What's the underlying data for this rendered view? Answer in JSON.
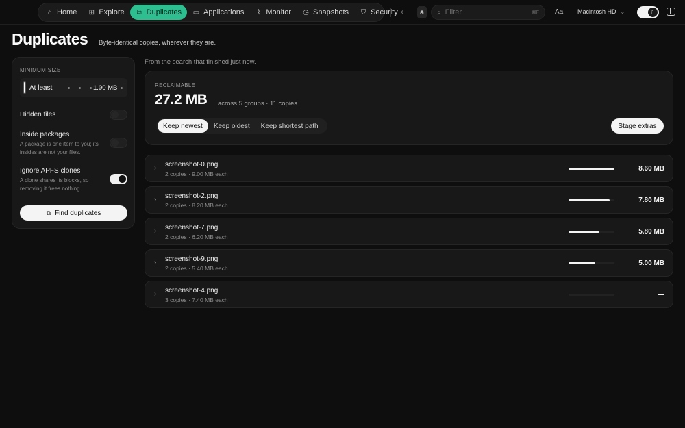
{
  "nav": {
    "items": [
      {
        "label": "Home",
        "icon": "home-icon",
        "glyph": "⌂",
        "active": false
      },
      {
        "label": "Explore",
        "icon": "grid-icon",
        "glyph": "⊞",
        "active": false
      },
      {
        "label": "Duplicates",
        "icon": "copy-icon",
        "glyph": "⧉",
        "active": true
      },
      {
        "label": "Applications",
        "icon": "monitor-icon",
        "glyph": "▭",
        "active": false
      },
      {
        "label": "Monitor",
        "icon": "pulse-icon",
        "glyph": "⌇",
        "active": false
      },
      {
        "label": "Snapshots",
        "icon": "clock-icon",
        "glyph": "◷",
        "active": false
      },
      {
        "label": "Security",
        "icon": "shield-icon",
        "glyph": "⛉",
        "active": false
      }
    ],
    "accent": "#2dbf8f"
  },
  "toolbar": {
    "a_chip": "a",
    "filter_placeholder": "Filter",
    "filter_shortcut": "⌘F",
    "text_size_label": "Aa",
    "volume": "Macintosh HD"
  },
  "page": {
    "title": "Duplicates",
    "subtitle": "Byte-identical copies, wherever they are."
  },
  "sidebar": {
    "min_size_label": "MINIMUM SIZE",
    "min_size_prefix": "At least",
    "min_size_value": "1.00 MB",
    "options": [
      {
        "title": "Hidden files",
        "desc": "",
        "on": false
      },
      {
        "title": "Inside packages",
        "desc": "A package is one item to you; its insides are not your files.",
        "on": false
      },
      {
        "title": "Ignore APFS clones",
        "desc": "A clone shares its blocks, so removing it frees nothing.",
        "on": true
      }
    ],
    "find_button": "Find duplicates"
  },
  "main": {
    "from_text": "From the search that finished just now.",
    "reclaimable_label": "RECLAIMABLE",
    "reclaimable_value": "27.2 MB",
    "reclaimable_meta": "across 5 groups · 11 copies",
    "keep_options": [
      "Keep newest",
      "Keep oldest",
      "Keep shortest path"
    ],
    "keep_selected": 0,
    "stage_button": "Stage extras"
  },
  "groups": [
    {
      "name": "screenshot-0.png",
      "detail": "2 copies · 9.00 MB each",
      "size": "8.60 MB",
      "fraction": 1.0
    },
    {
      "name": "screenshot-2.png",
      "detail": "2 copies · 8.20 MB each",
      "size": "7.80 MB",
      "fraction": 0.9
    },
    {
      "name": "screenshot-7.png",
      "detail": "2 copies · 6.20 MB each",
      "size": "5.80 MB",
      "fraction": 0.67
    },
    {
      "name": "screenshot-9.png",
      "detail": "2 copies · 5.40 MB each",
      "size": "5.00 MB",
      "fraction": 0.58
    },
    {
      "name": "screenshot-4.png",
      "detail": "3 copies · 7.40 MB each",
      "size": "—",
      "fraction": 0.0
    }
  ]
}
